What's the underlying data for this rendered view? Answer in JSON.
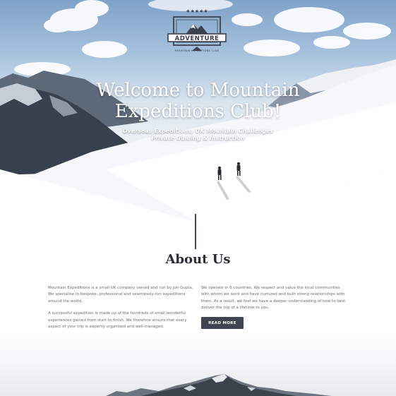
{
  "hero": {
    "title_line1": "Welcome to Mountain",
    "title_line2": "Expeditions Club!",
    "subtitle_line1": "Overseas Expeditions, UK Mountain Challenges",
    "subtitle_line2": "Private Guiding & Instruction"
  },
  "logo": {
    "title": "ADVENTURE",
    "subtitle": "MOUNTAIN EXPEDITIONS CLUB",
    "stars": "★★★★★"
  },
  "about": {
    "heading": "About Us",
    "left_paragraph_1": "Mountain Expeditions is a small UK company owned and run by Jon Gupta. We specialise in bespoke, professional and seamlessly-run expeditions around the world.",
    "left_paragraph_2": "A successful expedition is made up of the hundreds of small wonderful experiences gained from start to finish. We therefore ensure that every aspect of your trip is expertly organised and well-managed.",
    "right_paragraph_1": "We operate in 6 countries. We respect and value the local communities with whom we work and have nurtured and built strong relationships with them. As a result, we feel we have a deeper understanding of how to best deliver the trip of a lifetime to you.",
    "read_more_label": "READ MORE"
  },
  "colors": {
    "accent": "#3e4452",
    "text": "#6a6e75",
    "heading": "#2b2e34"
  }
}
